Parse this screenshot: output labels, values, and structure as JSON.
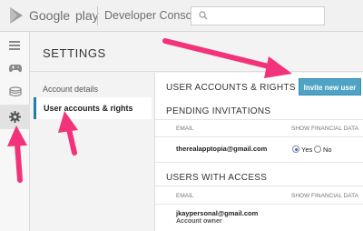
{
  "topbar": {
    "brand_google": "Google",
    "brand_play": "play",
    "product": "Developer Console",
    "search": {
      "value": "",
      "placeholder": ""
    }
  },
  "rail": {
    "icons": [
      "menu-icon",
      "gamepad-icon",
      "coins-icon",
      "gear-icon"
    ]
  },
  "settings": {
    "title": "SETTINGS",
    "nav": [
      {
        "label": "Account details"
      },
      {
        "label": "User accounts & rights",
        "active": true
      }
    ]
  },
  "main": {
    "heading": "USER ACCOUNTS & RIGHTS",
    "invite_label": "Invite new user",
    "pending": {
      "heading": "PENDING INVITATIONS",
      "col_email": "EMAIL",
      "col_financial": "SHOW FINANCIAL DATA",
      "rows": [
        {
          "email": "therealapptopia@gmail.com",
          "yes": "Yes",
          "no": "No",
          "selected": "Yes"
        }
      ]
    },
    "users": {
      "heading": "USERS WITH ACCESS",
      "col_email": "EMAIL",
      "col_financial": "SHOW FINANCIAL DATA",
      "rows": [
        {
          "email": "jkaypersonal@gmail.com",
          "role": "Account owner"
        }
      ]
    }
  },
  "colors": {
    "accent": "#4fa3c4",
    "nav_active_border": "#1f7da9",
    "arrow": "#f2327a"
  }
}
